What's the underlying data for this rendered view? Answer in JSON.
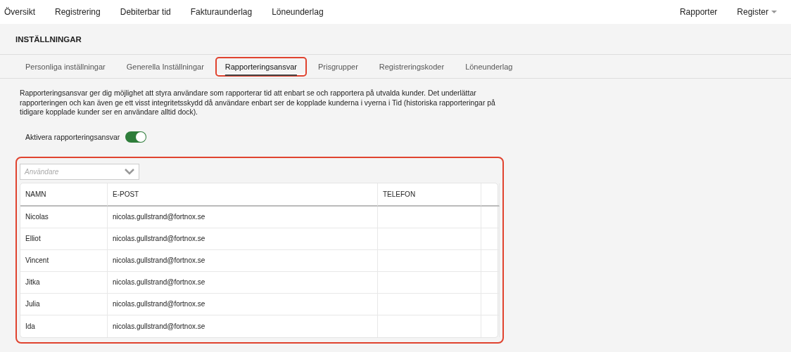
{
  "nav": {
    "left": [
      "Översikt",
      "Registrering",
      "Debiterbar tid",
      "Fakturaunderlag",
      "Löneunderlag"
    ],
    "right": [
      {
        "label": "Rapporter",
        "kind": "link"
      },
      {
        "label": "Register",
        "kind": "dropdown"
      }
    ]
  },
  "page_title": "INSTÄLLNINGAR",
  "tabs": [
    {
      "label": "Personliga inställningar",
      "selected": false,
      "highlighted": false
    },
    {
      "label": "Generella Inställningar",
      "selected": false,
      "highlighted": false
    },
    {
      "label": "Rapporteringsansvar",
      "selected": true,
      "highlighted": true
    },
    {
      "label": "Prisgrupper",
      "selected": false,
      "highlighted": false
    },
    {
      "label": "Registreringskoder",
      "selected": false,
      "highlighted": false
    },
    {
      "label": "Löneunderlag",
      "selected": false,
      "highlighted": false
    }
  ],
  "description": "Rapporteringsansvar ger dig möjlighet att styra användare som rapporterar tid att enbart se och rapportera på utvalda kunder. Det underlättar rapporteringen och kan även ge ett visst integritetsskydd då användare enbart ser de kopplade kunderna i vyerna i Tid (historiska rapporteringar på tidigare kopplade kunder ser en användare alltid dock).",
  "toggle": {
    "label": "Aktivera rapporteringsansvar",
    "on": true
  },
  "users_panel": {
    "highlighted": true,
    "select": {
      "placeholder": "Användare"
    },
    "table": {
      "columns": [
        "NAMN",
        "E-POST",
        "TELEFON"
      ],
      "rows": [
        [
          "Nicolas",
          "nicolas.gullstrand@fortnox.se"
        ],
        [
          "Elliot",
          "nicolas.gullstrand@fortnox.se"
        ],
        [
          "Vincent",
          "nicolas.gullstrand@fortnox.se"
        ],
        [
          "Jitka",
          "nicolas.gullstrand@fortnox.se"
        ],
        [
          "Julia",
          "nicolas.gullstrand@fortnox.se"
        ],
        [
          "Ida",
          "nicolas.gullstrand@fortnox.se"
        ]
      ]
    }
  }
}
